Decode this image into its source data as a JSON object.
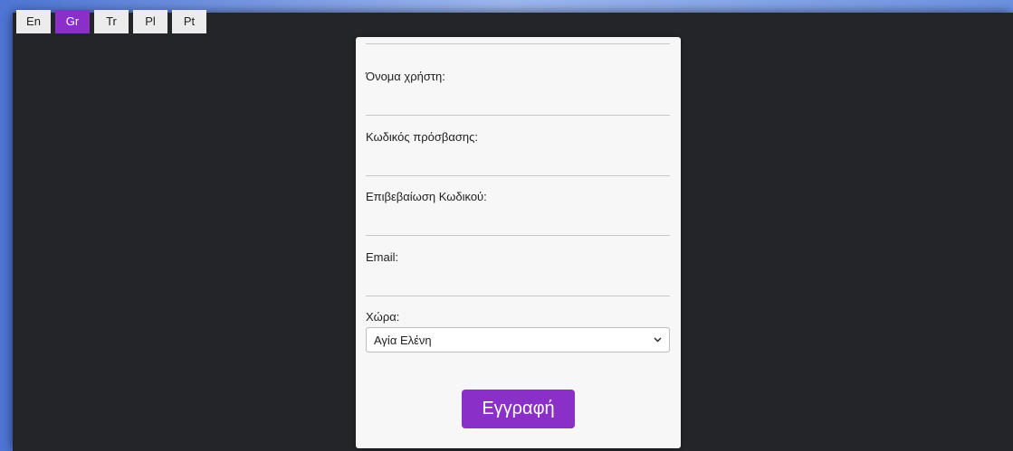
{
  "languages": [
    {
      "label": "En",
      "active": false
    },
    {
      "label": "Gr",
      "active": true
    },
    {
      "label": "Tr",
      "active": false
    },
    {
      "label": "Pl",
      "active": false
    },
    {
      "label": "Pt",
      "active": false
    }
  ],
  "form": {
    "username_label": "Όνομα χρήστη:",
    "username_value": "",
    "password_label": "Κωδικός πρόσβασης:",
    "password_value": "",
    "confirm_label": "Επιβεβαίωση Κωδικού:",
    "confirm_value": "",
    "email_label": "Email:",
    "email_value": "",
    "country_label": "Χώρα:",
    "country_selected": "Αγία Ελένη",
    "submit_label": "Εγγραφή"
  },
  "colors": {
    "accent": "#8b2fc9",
    "page_background": "#242529",
    "card_background": "#f7f7f7"
  },
  "icons": {
    "select_arrow": "chevron-down-icon"
  }
}
